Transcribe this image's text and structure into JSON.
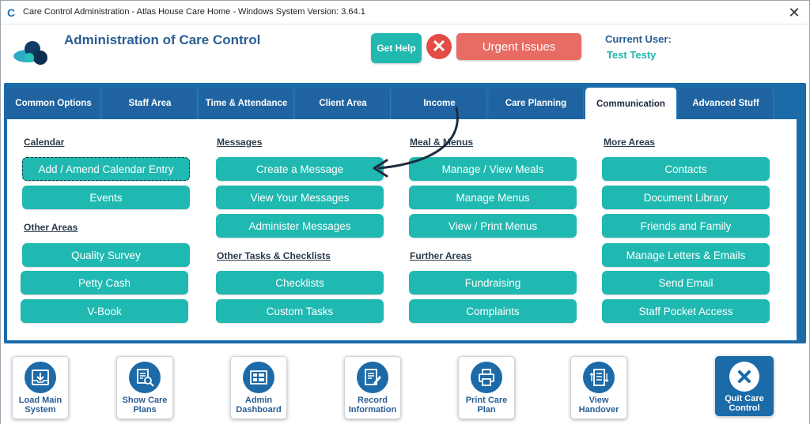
{
  "window": {
    "title": "Care Control Administration - Atlas House Care Home - Windows System Version: 3.64.1",
    "close_symbol": "✕",
    "app_icon_letter": "C"
  },
  "header": {
    "title": "Administration of Care Control",
    "help_label": "Get Help",
    "urgent_icon": "✕",
    "urgent_label": "Urgent Issues",
    "current_user_label": "Current User:",
    "current_user_name": "Test Testy"
  },
  "tabs": [
    {
      "label": "Common Options"
    },
    {
      "label": "Staff Area"
    },
    {
      "label": "Time & Attendance"
    },
    {
      "label": "Client Area"
    },
    {
      "label": "Income"
    },
    {
      "label": "Care Planning"
    },
    {
      "label": "Communication",
      "active": true
    },
    {
      "label": "Advanced Stuff"
    }
  ],
  "sections": {
    "calendar": {
      "title": "Calendar",
      "buttons": [
        "Add / Amend Calendar Entry",
        "Events"
      ]
    },
    "other_areas": {
      "title": "Other Areas",
      "buttons": [
        "Quality Survey",
        "Petty Cash",
        "V-Book"
      ]
    },
    "messages": {
      "title": "Messages",
      "buttons": [
        "Create a Message",
        "View Your Messages",
        "Administer Messages"
      ]
    },
    "other_tasks": {
      "title": "Other Tasks & Checklists",
      "buttons": [
        "Checklists",
        "Custom Tasks"
      ]
    },
    "meals": {
      "title": "Meal & Menus",
      "buttons": [
        "Manage / View Meals",
        "Manage Menus",
        "View / Print Menus"
      ]
    },
    "further_areas": {
      "title": "Further Areas",
      "buttons": [
        "Fundraising",
        "Complaints"
      ]
    },
    "more_areas": {
      "title": "More Areas",
      "buttons": [
        "Contacts",
        "Document Library",
        "Friends and Family",
        "Manage Letters & Emails",
        "Send Email",
        "Staff Pocket Access"
      ]
    }
  },
  "bottom_bar": [
    {
      "line1": "Load Main",
      "line2": "System",
      "icon": "download-tray-icon"
    },
    {
      "line1": "Show Care",
      "line2": "Plans",
      "icon": "document-search-icon"
    },
    {
      "line1": "Admin",
      "line2": "Dashboard",
      "icon": "dashboard-grid-icon"
    },
    {
      "line1": "Record",
      "line2": "Information",
      "icon": "edit-document-icon"
    },
    {
      "line1": "Print Care",
      "line2": "Plan",
      "icon": "printer-icon"
    },
    {
      "line1": "View",
      "line2": "Handover",
      "icon": "handover-list-icon"
    },
    {
      "line1": "Quit Care",
      "line2": "Control",
      "icon": "close-circle-icon"
    }
  ],
  "colors": {
    "accent": "#20b9b1",
    "tab_blue": "#1b6ba9",
    "urgent_red": "#e86b64",
    "title_blue": "#2a5e93"
  }
}
